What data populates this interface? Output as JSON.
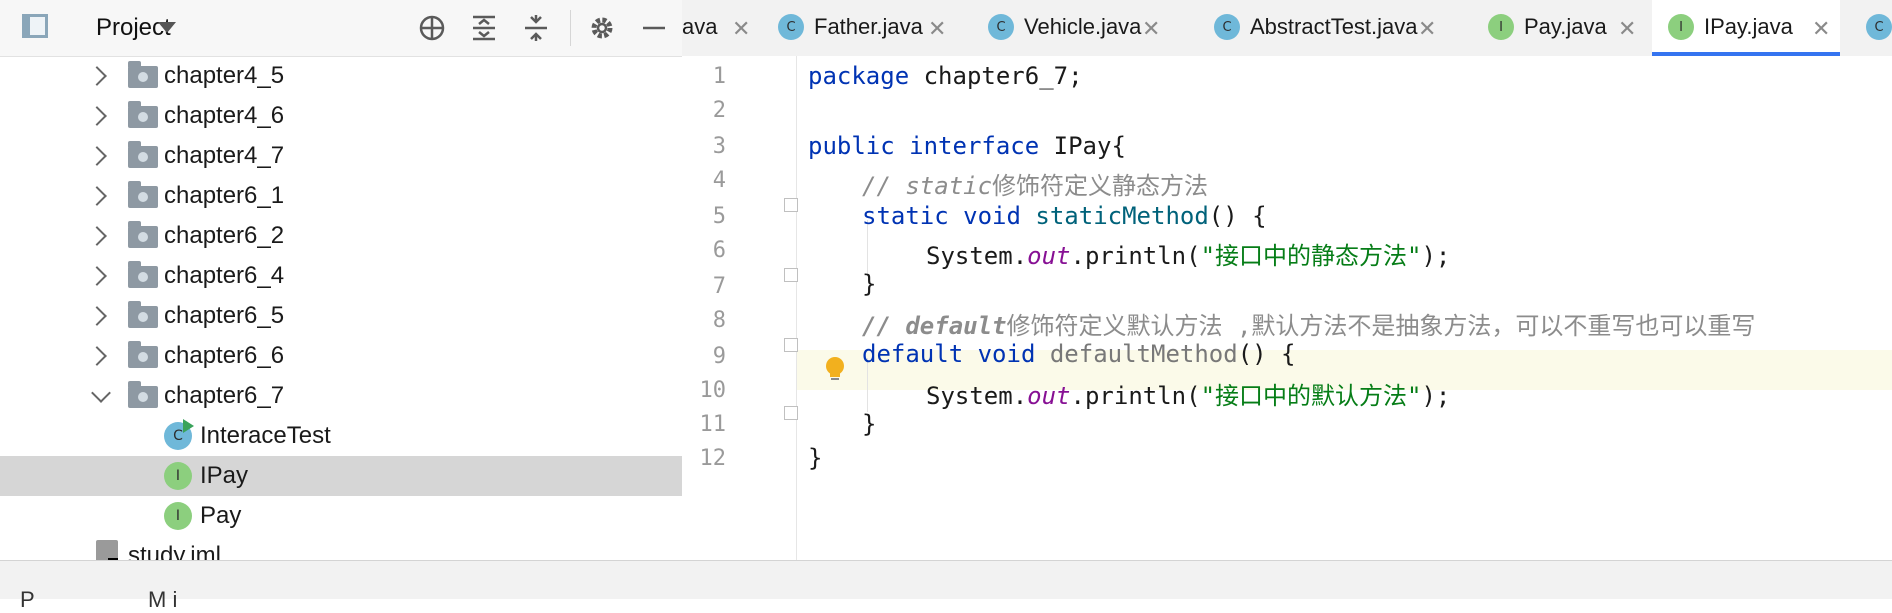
{
  "project_panel": {
    "title": "Project",
    "tree": [
      {
        "label": "chapter4_5",
        "type": "folder",
        "expanded": false
      },
      {
        "label": "chapter4_6",
        "type": "folder",
        "expanded": false
      },
      {
        "label": "chapter4_7",
        "type": "folder",
        "expanded": false
      },
      {
        "label": "chapter6_1",
        "type": "folder",
        "expanded": false
      },
      {
        "label": "chapter6_2",
        "type": "folder",
        "expanded": false
      },
      {
        "label": "chapter6_4",
        "type": "folder",
        "expanded": false
      },
      {
        "label": "chapter6_5",
        "type": "folder",
        "expanded": false
      },
      {
        "label": "chapter6_6",
        "type": "folder",
        "expanded": false
      },
      {
        "label": "chapter6_7",
        "type": "folder",
        "expanded": true
      },
      {
        "label": "InteraceTest",
        "type": "class-runnable",
        "badge": "C"
      },
      {
        "label": "IPay",
        "type": "interface",
        "badge": "I",
        "selected": true
      },
      {
        "label": "Pay",
        "type": "interface",
        "badge": "I"
      },
      {
        "label": "study.iml",
        "type": "iml"
      }
    ]
  },
  "tabs": [
    {
      "label": "ava",
      "badge": ""
    },
    {
      "label": "Father.java",
      "badge": "C"
    },
    {
      "label": "Vehicle.java",
      "badge": "C"
    },
    {
      "label": "AbstractTest.java",
      "badge": "C"
    },
    {
      "label": "Pay.java",
      "badge": "I"
    },
    {
      "label": "IPay.java",
      "badge": "I",
      "active": true
    },
    {
      "label": "",
      "badge": "C"
    }
  ],
  "editor": {
    "line_numbers": [
      "1",
      "2",
      "3",
      "4",
      "5",
      "6",
      "7",
      "8",
      "9",
      "10",
      "11",
      "12"
    ],
    "lines": {
      "l1_kw": "package",
      "l1_rest": " chapter6_7;",
      "l3_kw1": "public",
      "l3_kw2": "interface",
      "l3_rest": " IPay{",
      "l4_comment_a": "// static",
      "l4_comment_b": "修饰符定义静态方法",
      "l5_kw1": "static",
      "l5_kw2": "void",
      "l5_method": "staticMethod",
      "l5_rest": "() {",
      "l6_a": "System.",
      "l6_field": "out",
      "l6_b": ".println(",
      "l6_str": "\"接口中的静态方法\"",
      "l6_c": ");",
      "l7": "}",
      "l8_comment_a": "// default",
      "l8_comment_b": "修饰符定义默认方法 ,默认方法不是抽象方法，可以不重写也可以重写",
      "l9_kw1": "default",
      "l9_kw2": "void",
      "l9_method": "defaultMethod",
      "l9_rest": "() {",
      "l10_a": "System.",
      "l10_field": "out",
      "l10_b": ".println(",
      "l10_str": "\"接口中的默认方法\"",
      "l10_c": ");",
      "l11": "}",
      "l12": "}"
    }
  },
  "bottom_bar": {
    "left_text": "P",
    "right_text": "M  i"
  },
  "colors": {
    "keyword": "#0033b3",
    "string": "#067d17",
    "comment": "#8c8c8c",
    "field": "#871094",
    "active_tab_underline": "#3574f0",
    "interface_badge": "#8ccf7e",
    "class_badge": "#6fb8d9"
  }
}
